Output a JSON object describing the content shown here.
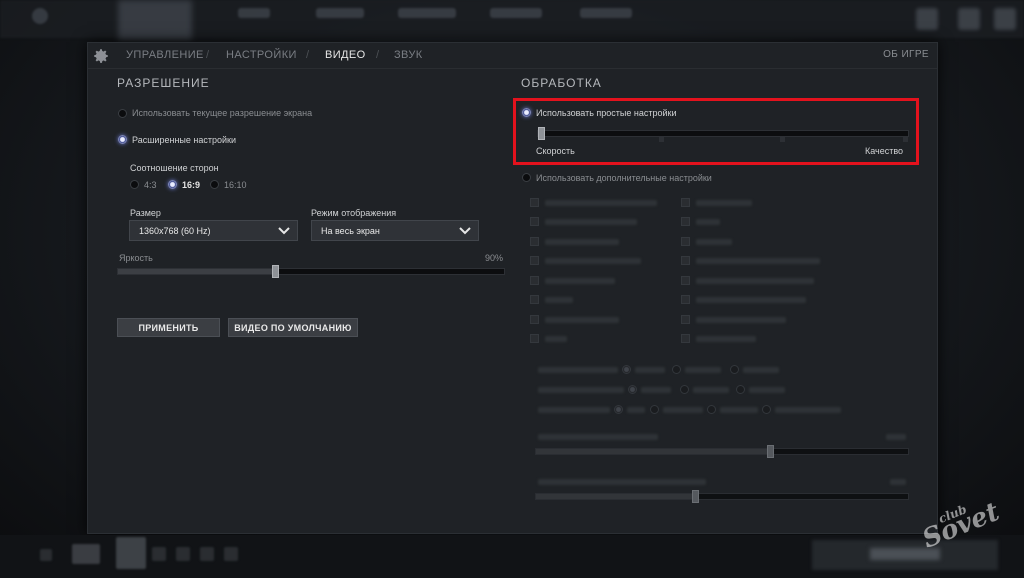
{
  "nav": {
    "tabs": [
      "УПРАВЛЕНИЕ",
      "НАСТРОЙКИ",
      "ВИДЕО",
      "ЗВУК"
    ],
    "active_tab": "ВИДЕО",
    "separator": "/",
    "about": "ОБ ИГРЕ"
  },
  "resolution": {
    "heading": "РАЗРЕШЕНИЕ",
    "use_current_label": "Использовать текущее разрешение экрана",
    "advanced_label": "Расширенные настройки",
    "aspect_label": "Соотношение сторон",
    "aspect_options": [
      "4:3",
      "16:9",
      "16:10"
    ],
    "aspect_selected": "16:9",
    "size_label": "Размер",
    "size_value": "1360x768 (60 Hz)",
    "display_mode_label": "Режим отображения",
    "display_mode_value": "На весь экран",
    "brightness_label": "Яркость",
    "brightness_value": "90%",
    "brightness_level": 0.4,
    "apply_label": "ПРИМЕНИТЬ",
    "defaults_label": "ВИДЕО ПО УМОЛЧАНИЮ"
  },
  "rendering": {
    "heading": "ОБРАБОТКА",
    "simple_label": "Использовать простые настройки",
    "speed_label": "Скорость",
    "quality_label": "Качество",
    "quality_level": 0.0,
    "advanced_label": "Использовать дополнительные настройки"
  },
  "colors": {
    "highlight": "#e3121d",
    "radio_on": "#6c7bd0"
  },
  "watermark": {
    "top": "club",
    "main": "Sovet"
  }
}
